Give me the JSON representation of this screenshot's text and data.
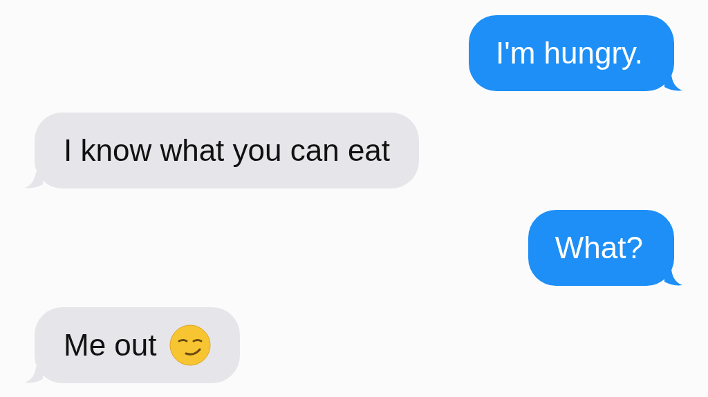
{
  "messages": [
    {
      "kind": "sent",
      "text": "I'm hungry.",
      "emoji": false
    },
    {
      "kind": "received",
      "text": "I know what you can eat",
      "emoji": false
    },
    {
      "kind": "sent",
      "text": "What?",
      "emoji": false
    },
    {
      "kind": "received",
      "text": "Me out",
      "emoji": true
    }
  ]
}
